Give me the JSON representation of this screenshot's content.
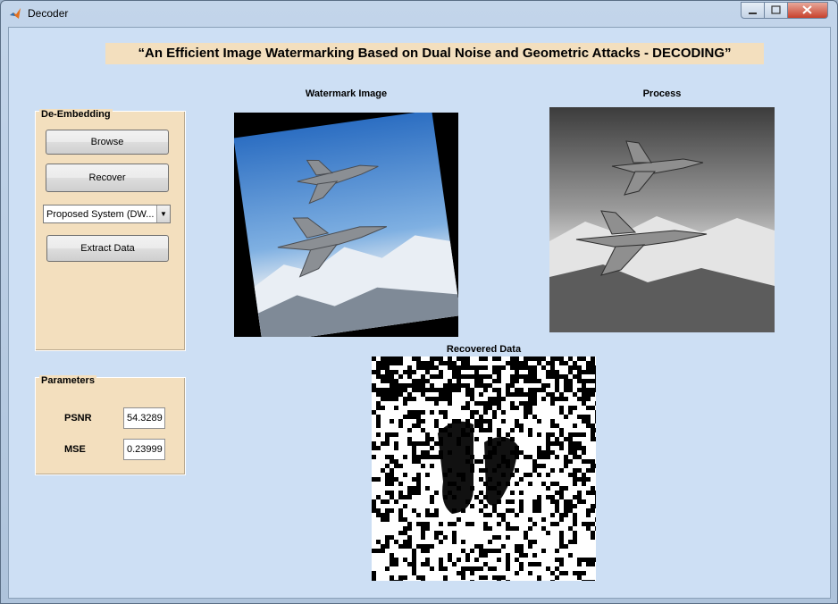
{
  "window": {
    "title": "Decoder",
    "icon": "matlab-icon"
  },
  "heading": "“An Efficient Image Watermarking Based on Dual Noise and Geometric Attacks - DECODING”",
  "de_embedding": {
    "title": "De-Embedding",
    "browse_label": "Browse",
    "recover_label": "Recover",
    "method_selected": "Proposed System (DW...",
    "extract_label": "Extract Data"
  },
  "parameters": {
    "title": "Parameters",
    "psnr_label": "PSNR",
    "psnr_value": "54.3289",
    "mse_label": "MSE",
    "mse_value": "0.23999"
  },
  "axes": {
    "watermark_title": "Watermark Image",
    "process_title": "Process",
    "recovered_title": "Recovered Data"
  },
  "colors": {
    "window_bg": "#cddff4",
    "panel_bg": "#f3dfbe",
    "heading_bg": "#f3dfbe"
  }
}
